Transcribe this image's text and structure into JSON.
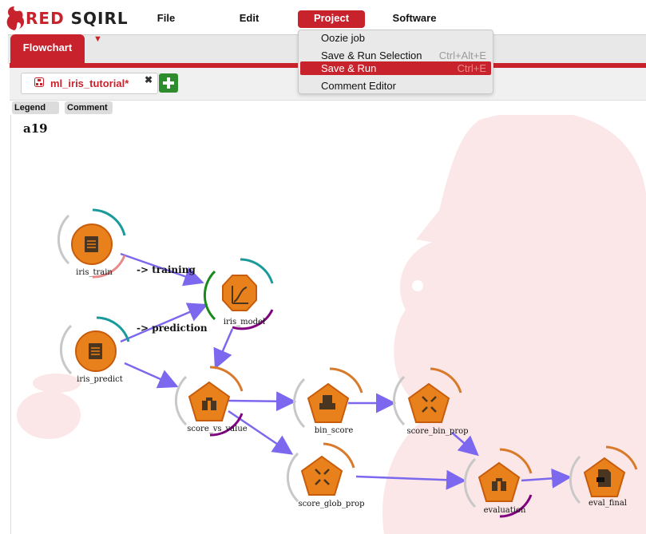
{
  "app": {
    "logo_text": "RED SQIRL",
    "accent_color": "#c8232c"
  },
  "menu": {
    "file": "File",
    "edit": "Edit",
    "project": "Project",
    "software": "Software"
  },
  "project_menu": {
    "items": [
      {
        "label": "Oozie job",
        "shortcut": ""
      },
      {
        "label": "Save & Run Selection",
        "shortcut": "Ctrl+Alt+E"
      },
      {
        "label": "Save & Run",
        "shortcut": "Ctrl+E",
        "highlighted": true
      },
      {
        "label": "Comment Editor",
        "shortcut": ""
      }
    ]
  },
  "tabs": {
    "flowchart": "Flowchart",
    "dropdown_icon": "triangle-down-icon"
  },
  "canvas_tab": {
    "label": "ml_iris_tutorial*",
    "close": "✖",
    "add_icon": "plus-icon"
  },
  "toolbar": {
    "legend": "Legend",
    "comment": "Comment"
  },
  "canvas": {
    "title": "a19",
    "nodes": [
      {
        "id": "iris_train",
        "label": "iris_train",
        "icon": "document-icon",
        "shape": "circle"
      },
      {
        "id": "iris_predict",
        "label": "iris_predict",
        "icon": "document-icon",
        "shape": "circle"
      },
      {
        "id": "iris_model",
        "label": "iris_model",
        "icon": "model-curve-icon",
        "shape": "octagon"
      },
      {
        "id": "score_vs_value",
        "label": "score_vs_value",
        "icon": "binoculars-icon",
        "shape": "pentagon"
      },
      {
        "id": "bin_score",
        "label": "bin_score",
        "icon": "printer-icon",
        "shape": "pentagon"
      },
      {
        "id": "score_bin_prop",
        "label": "score_bin_prop",
        "icon": "compress-arrows-icon",
        "shape": "pentagon"
      },
      {
        "id": "score_glob_prop",
        "label": "score_glob_prop",
        "icon": "compress-arrows-icon",
        "shape": "pentagon"
      },
      {
        "id": "evaluation",
        "label": "evaluation",
        "icon": "binoculars-icon",
        "shape": "pentagon"
      },
      {
        "id": "eval_final",
        "label": "eval_final",
        "icon": "file-icon",
        "shape": "pentagon"
      }
    ],
    "edge_labels": {
      "training": "-> training",
      "prediction": "-> prediction"
    }
  }
}
